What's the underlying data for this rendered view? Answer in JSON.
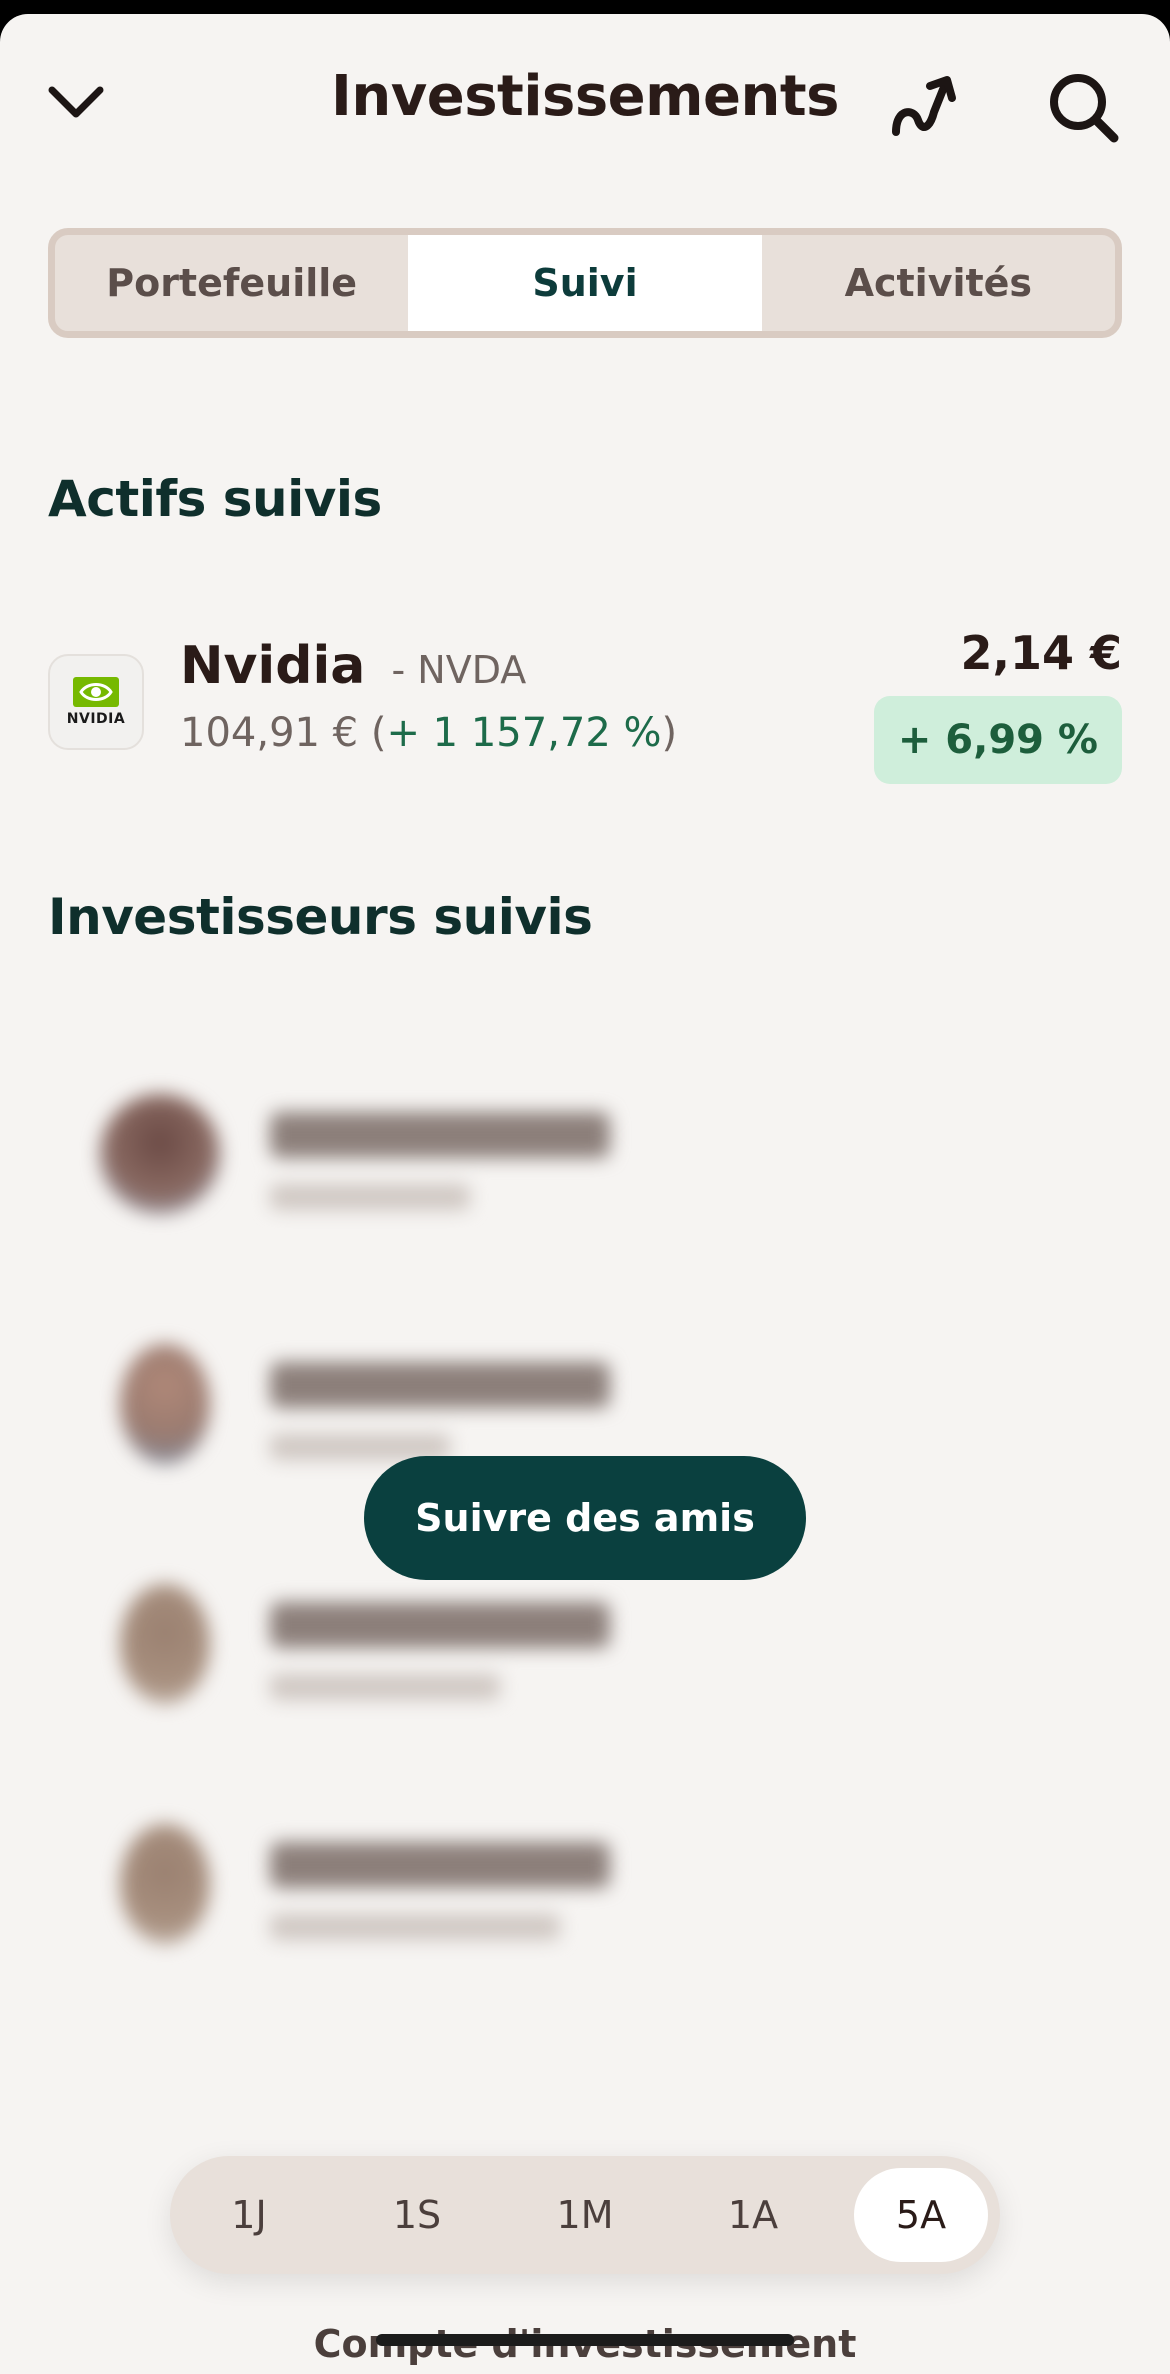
{
  "header": {
    "title": "Investissements",
    "icons": [
      "chevron-down-icon",
      "trend-arrow-icon",
      "search-icon"
    ]
  },
  "tabs": [
    {
      "label": "Portefeuille",
      "active": false
    },
    {
      "label": "Suivi",
      "active": true
    },
    {
      "label": "Activités",
      "active": false
    }
  ],
  "assets": {
    "section_title": "Actifs suivis",
    "items": [
      {
        "name": "Nvidia",
        "ticker": "- NVDA",
        "price": "104,91 €",
        "gain": "+ 1 157,72 %",
        "value": "2,14 €",
        "change": "+ 6,99 %",
        "logo_text": "NVIDIA"
      }
    ]
  },
  "investors": {
    "section_title": "Investisseurs suivis",
    "follow_button": "Suivre des amis"
  },
  "range": {
    "options": [
      "1J",
      "1S",
      "1M",
      "1A",
      "5A"
    ],
    "selected": "5A"
  },
  "footer": {
    "label": "Compte d'investissement"
  },
  "colors": {
    "background": "#f6f4f2",
    "accent": "#0a403f",
    "positive": "#1d6b4a",
    "positive_bg": "#cfeedb"
  }
}
